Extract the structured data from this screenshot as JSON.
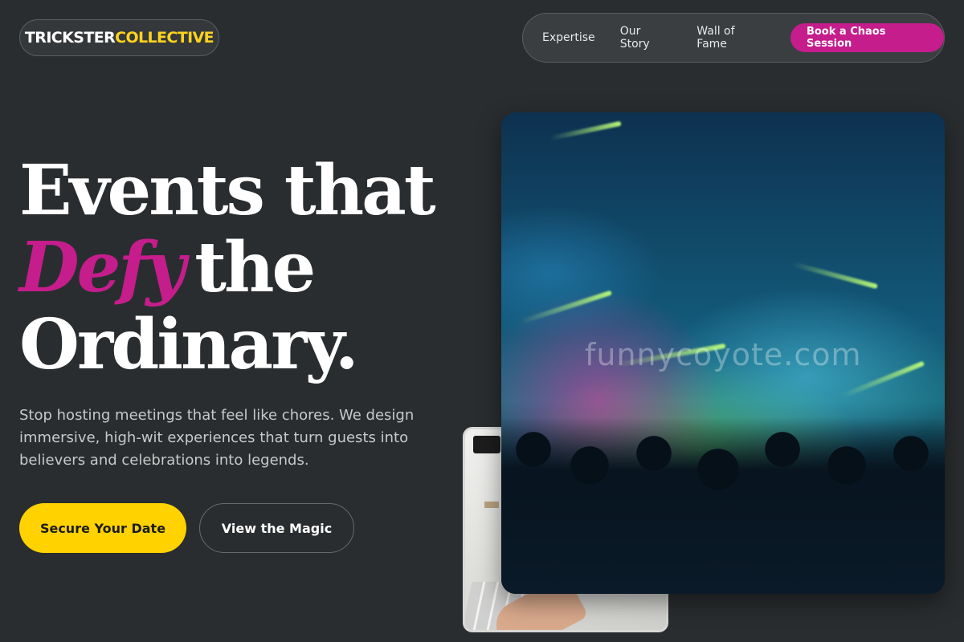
{
  "brand": {
    "part1": "TRICKSTER",
    "part2": "COLLECTIVE",
    "accent_color": "#ffd21f"
  },
  "nav": {
    "links": [
      "Expertise",
      "Our Story",
      "Wall of Fame"
    ],
    "cta": "Book a Chaos Session",
    "cta_color": "#c51d8c"
  },
  "hero": {
    "line1": "Events that",
    "line2_accent": "Defy",
    "line2_rest": "the",
    "line3": "Ordinary.",
    "description": "Stop hosting meetings that feel like chores. We design immersive, high-wit experiences that turn guests into believers and celebrations into legends.",
    "primary_button": "Secure Your Date",
    "secondary_button": "View the Magic"
  },
  "images": {
    "main_watermark": "funnycoyote.com",
    "main_alt": "concert-crowd-photo",
    "small_alt": "laptop-desk-photo"
  },
  "colors": {
    "background": "#2a2d2f",
    "primary_yellow": "#ffd200",
    "accent_magenta": "#c51d8c"
  }
}
